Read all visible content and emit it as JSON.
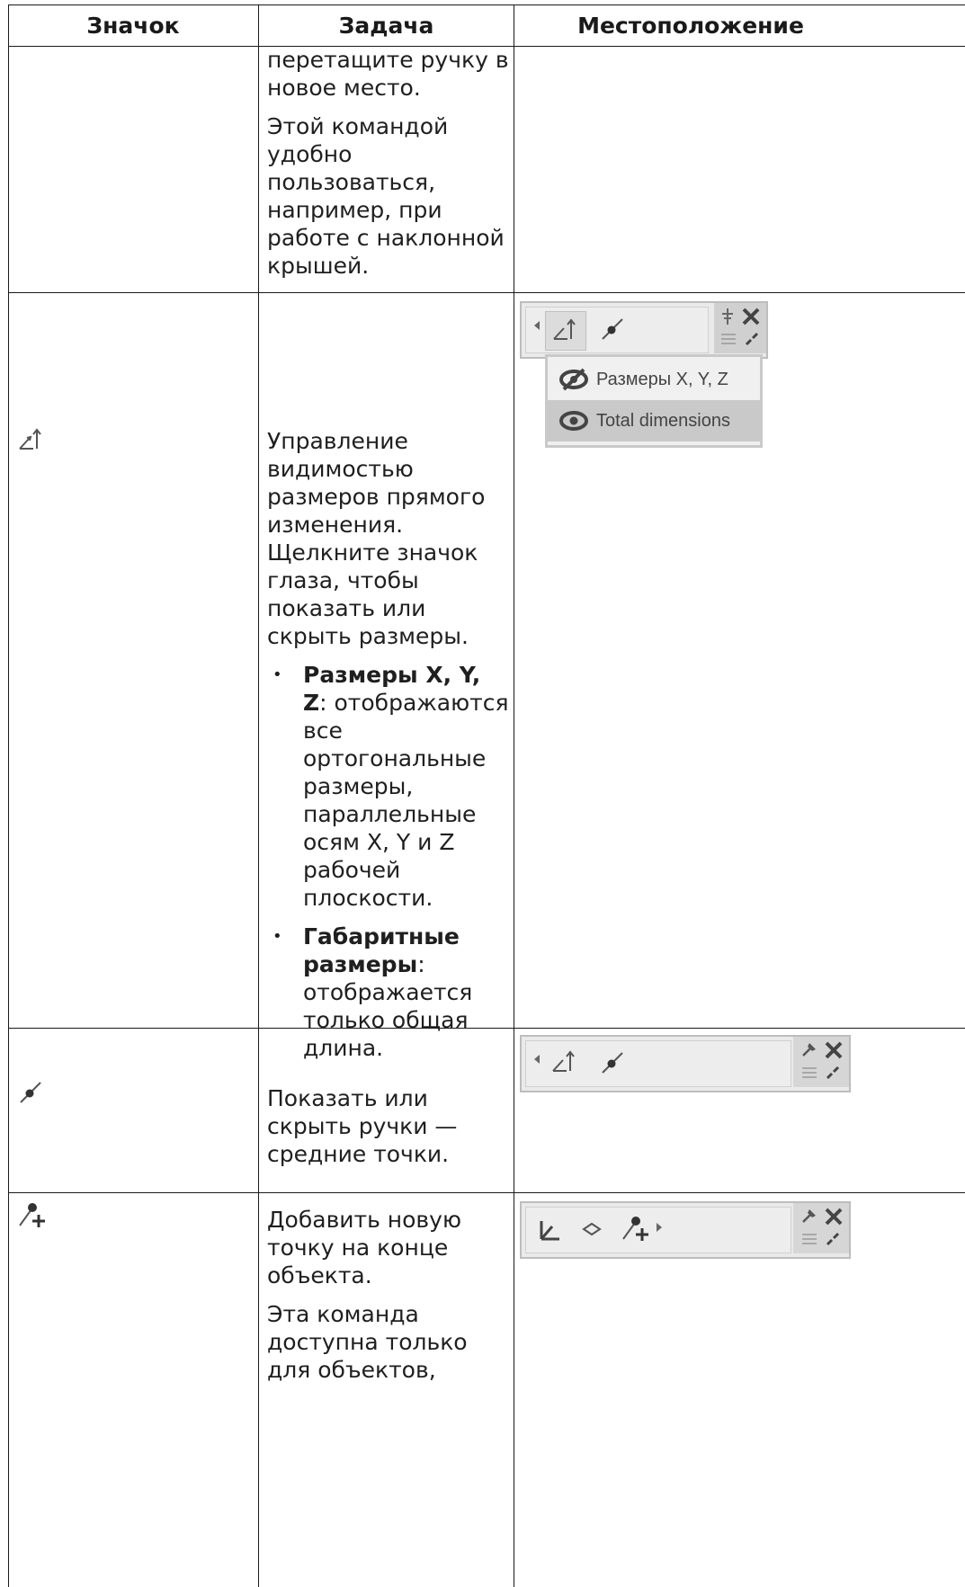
{
  "headers": {
    "icon": "Значок",
    "task": "Задача",
    "location": "Местоположение"
  },
  "rows": [
    {
      "paragraphs": [
        "перетащите ручку в новое место.",
        "Этой командой удобно пользоваться, например, при работе с наклонной крышей."
      ]
    },
    {
      "icon": "dimension-axes-icon",
      "paragraphs": [
        "Управление видимостью размеров прямого изменения. Щелкните значок глаза, чтобы показать или скрыть размеры."
      ],
      "bullets": [
        {
          "bold": "Размеры X, Y, Z",
          "text": ": отображаются все ортогональные размеры, параллельные осям X, Y и Z рабочей плоскости."
        },
        {
          "bold": "Габаритные размеры",
          "text": ": отображается только общая длина."
        }
      ],
      "screenshot": {
        "dropdown_items": [
          "Размеры X, Y, Z",
          "Total dimensions"
        ]
      }
    },
    {
      "icon": "handle-point-icon",
      "paragraphs": [
        "Показать или скрыть ручки — средние точки."
      ]
    },
    {
      "icon": "add-point-icon",
      "paragraphs": [
        "Добавить новую точку на конце объекта.",
        "Эта команда доступна только для объектов,"
      ]
    }
  ]
}
